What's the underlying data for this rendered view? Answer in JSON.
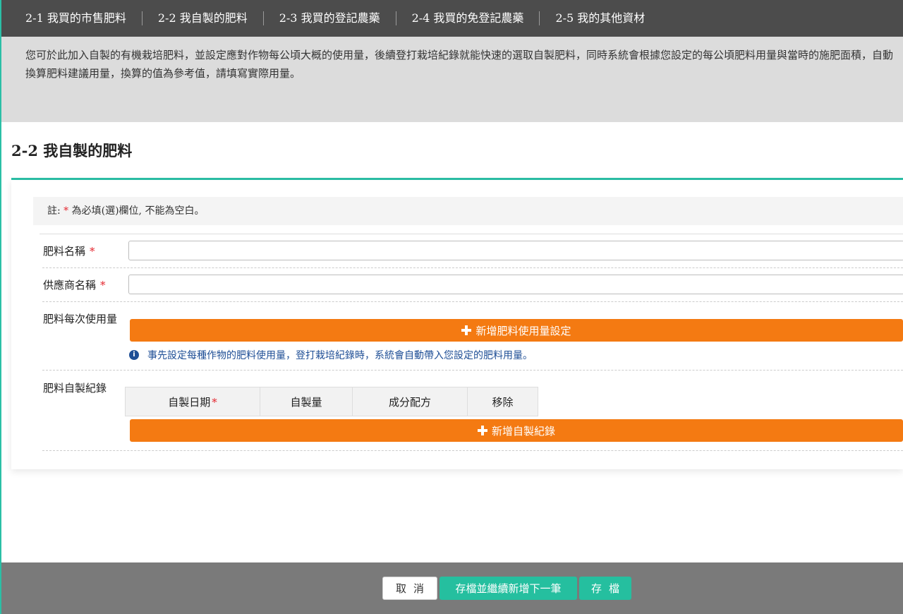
{
  "nav": {
    "tabs": [
      {
        "label": "2-1 我買的市售肥料"
      },
      {
        "label": "2-2 我自製的肥料"
      },
      {
        "label": "2-3 我買的登記農藥"
      },
      {
        "label": "2-4 我買的免登記農藥"
      },
      {
        "label": "2-5 我的其他資材"
      }
    ]
  },
  "intro": {
    "text": "您可於此加入自製的有機栽培肥料，並設定應對作物每公頃大概的使用量，後續登打栽培紀錄就能快速的選取自製肥料，同時系統會根據您設定的每公頃肥料用量與當時的施肥面積，自動換算肥料建議用量，換算的值為參考值，請填寫實際用量。"
  },
  "page": {
    "title": "2-2 我自製的肥料"
  },
  "form": {
    "note_prefix": "註:",
    "note_star": "*",
    "note_suffix": "為必填(選)欄位, 不能為空白。",
    "required_mark": "*",
    "fields": {
      "fertilizer_name": {
        "label": "肥料名稱",
        "value": ""
      },
      "supplier_name": {
        "label": "供應商名稱",
        "value": ""
      },
      "usage": {
        "label": "肥料每次使用量",
        "add_button": "新增肥料使用量設定",
        "hint": "事先設定每種作物的肥料使用量，登打栽培紀錄時，系統會自動帶入您設定的肥料用量。"
      },
      "records": {
        "label": "肥料自製紀錄",
        "columns": [
          {
            "label": "自製日期",
            "required": true
          },
          {
            "label": "自製量",
            "required": false
          },
          {
            "label": "成分配方",
            "required": false
          },
          {
            "label": "移除",
            "required": false
          }
        ],
        "add_button": "新增自製紀錄"
      }
    }
  },
  "footer": {
    "cancel": "取消",
    "save_and_next": "存檔並繼續新增下一筆",
    "save": "存檔"
  },
  "colors": {
    "accent_teal": "#2bbfa6",
    "button_teal": "#25bf9f",
    "button_orange": "#f47a12",
    "nav_bg": "#4c4c4c",
    "required_red": "#e4262e",
    "hint_blue": "#1f4f96"
  },
  "icons": {
    "plus": "plus-icon",
    "info": "info-icon"
  }
}
